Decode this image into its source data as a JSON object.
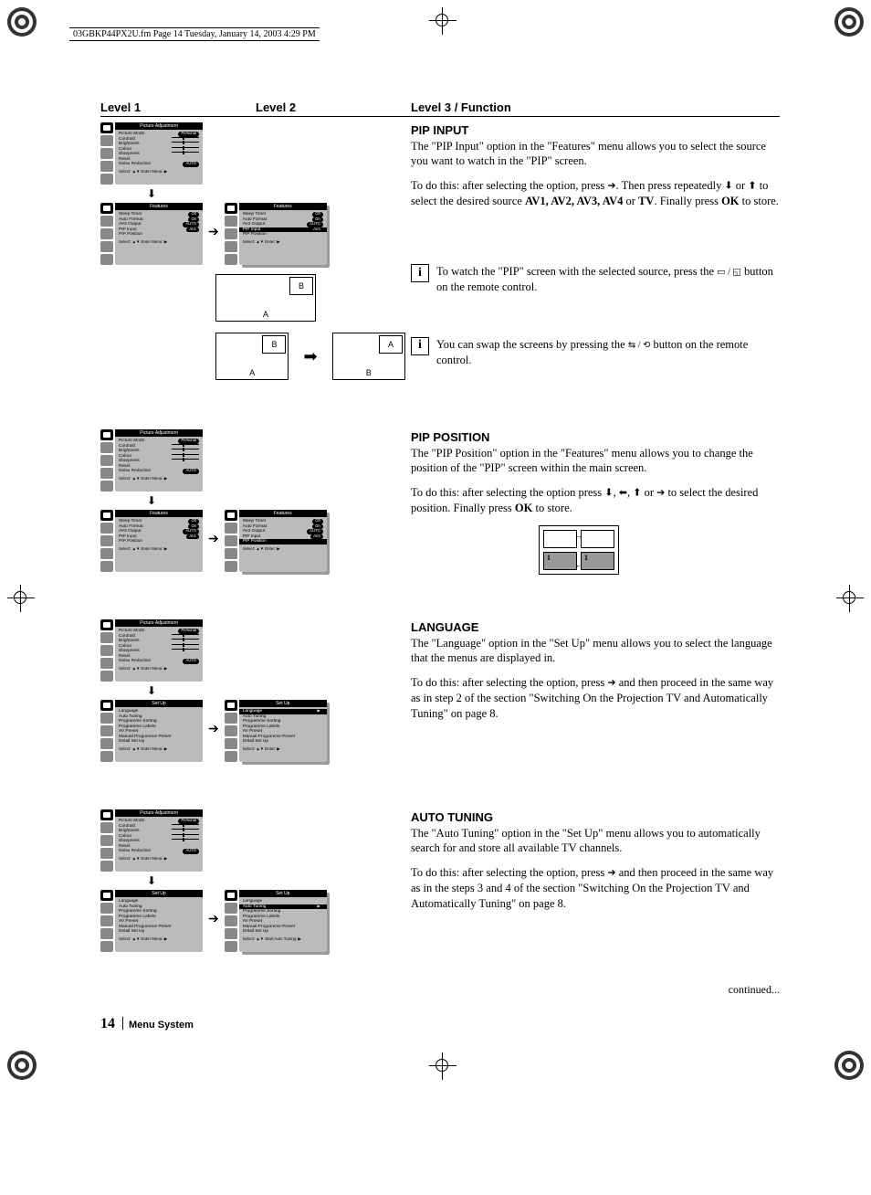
{
  "meta_header": "03GBKP44PX2U.fm  Page 14  Tuesday, January 14, 2003  4:29 PM",
  "levels": {
    "l1": "Level 1",
    "l2": "Level 2",
    "l3": "Level 3 / Function"
  },
  "picture_adjustment": {
    "title": "Picture Adjustment",
    "rows": [
      {
        "label": "Picture Mode",
        "val": "Personal"
      },
      {
        "label": "Contrast",
        "slider": true
      },
      {
        "label": "Brightness",
        "slider": true
      },
      {
        "label": "Colour",
        "slider": true
      },
      {
        "label": "Sharpness",
        "slider": true
      },
      {
        "label": "Reset",
        "val": ""
      },
      {
        "label": "Noise Reduction",
        "val": "AUTO"
      }
    ],
    "foot": "Select: ▲▼  Enter Menu: ▶"
  },
  "features_l1": {
    "title": "Features",
    "rows": [
      {
        "label": "Sleep Timer",
        "val": "Off"
      },
      {
        "label": "Auto Format",
        "val": "On"
      },
      {
        "label": "AV3 Output",
        "val": "AUTO"
      },
      {
        "label": "PIP Input",
        "val": "AV1"
      },
      {
        "label": "PIP Position",
        "val": ""
      }
    ],
    "foot": "Select: ▲▼  Enter Menu: ▶"
  },
  "features_l2_pipinput": {
    "title": "Features",
    "rows": [
      {
        "label": "Sleep Timer",
        "val": "Off"
      },
      {
        "label": "Auto Format",
        "val": "On"
      },
      {
        "label": "AV3 Output",
        "val": "AUTO"
      },
      {
        "label": "PIP Input",
        "val": "AV3",
        "sel": true
      },
      {
        "label": "PIP Position",
        "val": ""
      }
    ],
    "foot": "Select: ▲▼   Enter: ▶"
  },
  "features_l2_pippos": {
    "title": "Features",
    "rows": [
      {
        "label": "Sleep Timer",
        "val": "Off"
      },
      {
        "label": "Auto Format",
        "val": "On"
      },
      {
        "label": "AV3 Output",
        "val": "AUTO"
      },
      {
        "label": "PIP Input",
        "val": "AV3"
      },
      {
        "label": "PIP Position",
        "val": "",
        "sel": true
      }
    ],
    "foot": "Select: ▲▼   Enter: ▶"
  },
  "setup_l1": {
    "title": "Set Up",
    "rows": [
      {
        "label": "Language"
      },
      {
        "label": "Auto Tuning"
      },
      {
        "label": "Programme Sorting"
      },
      {
        "label": "Programme Labels"
      },
      {
        "label": "AV Preset"
      },
      {
        "label": "Manual Programme Preset"
      },
      {
        "label": "Detail Set Up"
      }
    ],
    "foot": "Select: ▲▼  Enter Menu: ▶"
  },
  "setup_l2_lang": {
    "title": "Set Up",
    "rows": [
      {
        "label": "Language",
        "sel": true,
        "val": "▶"
      },
      {
        "label": "Auto Tuning"
      },
      {
        "label": "Programme Sorting"
      },
      {
        "label": "Programme Labels"
      },
      {
        "label": "AV Preset"
      },
      {
        "label": "Manual Programme Preset"
      },
      {
        "label": "Detail Set Up"
      }
    ],
    "foot": "Select: ▲▼   Enter: ▶"
  },
  "setup_l2_auto": {
    "title": "Set Up",
    "rows": [
      {
        "label": "Language"
      },
      {
        "label": "Auto Tuning",
        "sel": true,
        "val": "▶"
      },
      {
        "label": "Programme Sorting"
      },
      {
        "label": "Programme Labels"
      },
      {
        "label": "AV Preset"
      },
      {
        "label": "Manual Programme Preset"
      },
      {
        "label": "Detail Set Up"
      }
    ],
    "foot": "Select: ▲▼  Start Auto Tuning: ▶"
  },
  "pip_input": {
    "title": "PIP INPUT",
    "p1": "The \"PIP Input\" option in the \"Features\"  menu allows you to select the source you want to watch in the \"PIP\" screen.",
    "p2a": "To do this: after selecting the option, press ",
    "p2b": ". Then press repeatedly ",
    "p2c": " or ",
    "p2d": " to select the desired source ",
    "p2e": "AV1, AV2, AV3, AV4",
    "p2f": " or ",
    "p2g": "TV",
    "p2h": ". Finally press ",
    "p2i": "OK",
    "p2j": " to store.",
    "info1a": "To watch the \"PIP\" screen with the selected source, press the ",
    "info1b": " button on the remote control.",
    "info2a": "You can swap the screens by pressing the ",
    "info2b": " button on the remote control.",
    "boxA": "A",
    "boxB": "B"
  },
  "pip_position": {
    "title": "PIP POSITION",
    "p1": "The \"PIP Position\" option in the \"Features\" menu allows you to change the position of the \"PIP\" screen within the main screen.",
    "p2a": "To do this: after selecting the option press  ",
    "p2b": ",  ",
    "p2c": " or ",
    "p2d": " to select the desired position. Finally press ",
    "p2e": "OK",
    "p2f": " to store.",
    "q1": "1",
    "q2": "1"
  },
  "language": {
    "title": "LANGUAGE",
    "p1": "The \"Language\" option in the \"Set Up\" menu allows you to select the language that the menus are displayed in.",
    "p2a": "To do this: after selecting the option, press ",
    "p2b": " and then proceed in the same way as in step 2 of the section \"Switching On the Projection TV and Automatically Tuning\" on page 8."
  },
  "auto_tuning": {
    "title": "AUTO TUNING",
    "p1": "The \"Auto Tuning\" option in the \"Set Up\" menu allows you to automatically search for and store all available TV channels.",
    "p2a": "To do this: after selecting the option, press ",
    "p2b": " and then proceed in the same way as in the steps 3 and 4 of the section \"Switching On the Projection TV and Automatically Tuning\" on page 8."
  },
  "continued": "continued...",
  "footer": {
    "page": "14",
    "title": "Menu System"
  }
}
